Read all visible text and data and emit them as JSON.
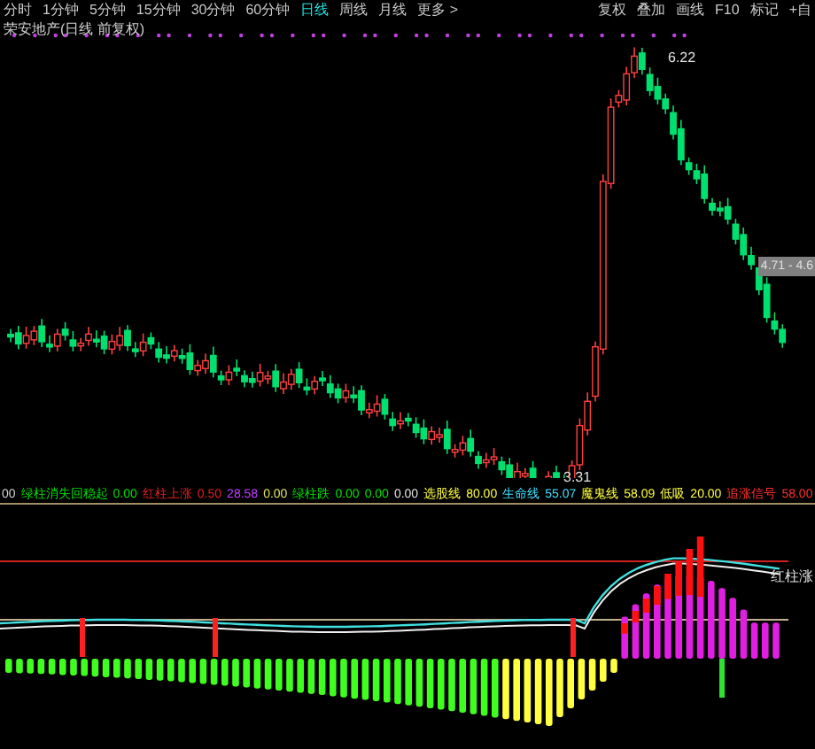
{
  "period_tabs": [
    {
      "label": "分时",
      "selected": false
    },
    {
      "label": "1分钟",
      "selected": false
    },
    {
      "label": "5分钟",
      "selected": false
    },
    {
      "label": "15分钟",
      "selected": false
    },
    {
      "label": "30分钟",
      "selected": false
    },
    {
      "label": "60分钟",
      "selected": false
    },
    {
      "label": "日线",
      "selected": true
    },
    {
      "label": "周线",
      "selected": false
    },
    {
      "label": "月线",
      "selected": false
    },
    {
      "label": "更多 >",
      "selected": false
    }
  ],
  "tools": [
    "复权",
    "叠加",
    "画线",
    "F10",
    "标记",
    "+自"
  ],
  "chart_title": "荣安地产(日线 前复权)",
  "price_labels": {
    "high": "6.22",
    "low": "3.31",
    "current": "4.71 - 4.6"
  },
  "indicator_legend": [
    {
      "text": "00",
      "color": "#d0d0d0"
    },
    {
      "text": "绿柱消失回稳起",
      "color": "#00e000"
    },
    {
      "text": "0.00",
      "color": "#00e000"
    },
    {
      "text": "红柱上涨",
      "color": "#e02020"
    },
    {
      "text": "0.50",
      "color": "#e02020"
    },
    {
      "text": "28.58",
      "color": "#c040ff"
    },
    {
      "text": "0.00",
      "color": "#e0e060"
    },
    {
      "text": "绿柱跌",
      "color": "#00e000"
    },
    {
      "text": "0.00",
      "color": "#00e000"
    },
    {
      "text": "0.00",
      "color": "#00e000"
    },
    {
      "text": "0.00",
      "color": "#e0e0e0"
    },
    {
      "text": "选股线",
      "color": "#ffff40"
    },
    {
      "text": "80.00",
      "color": "#ffff40"
    },
    {
      "text": "生命线",
      "color": "#40e0ff"
    },
    {
      "text": "55.07",
      "color": "#40e0ff"
    },
    {
      "text": "魔鬼线",
      "color": "#ffff40"
    },
    {
      "text": "58.09",
      "color": "#ffff40"
    },
    {
      "text": "低吸",
      "color": "#ffff40"
    },
    {
      "text": "20.00",
      "color": "#ffff40"
    },
    {
      "text": "追涨信号",
      "color": "#ff3030"
    },
    {
      "text": "58.00",
      "color": "#ff3030"
    }
  ],
  "indicator_tag": "红柱涨"
}
